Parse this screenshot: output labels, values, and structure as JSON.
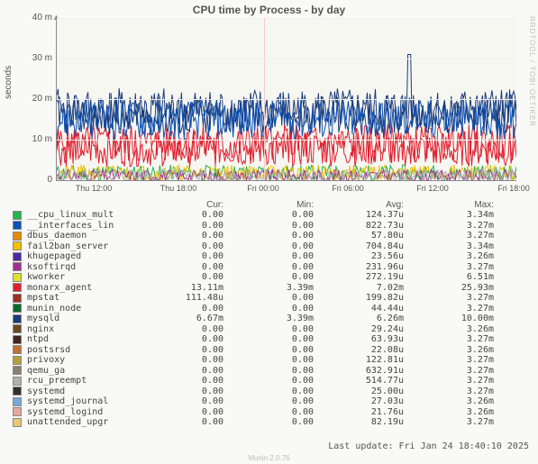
{
  "title": "CPU time by Process - by day",
  "ylabel": "seconds",
  "watermark": "RRDTOOL / TOBI OETIKER",
  "footer": "Munin 2.0.76",
  "last_update": "Last update: Fri Jan 24 18:40:10 2025",
  "y_ticks": [
    "0",
    "10 m",
    "20 m",
    "30 m",
    "40 m"
  ],
  "x_ticks": [
    "Thu 12:00",
    "Thu 18:00",
    "Fri 00:00",
    "Fri 06:00",
    "Fri 12:00",
    "Fri 18:00"
  ],
  "headers": [
    "",
    "Cur:",
    "Min:",
    "Avg:",
    "Max:"
  ],
  "rows": [
    {
      "color": "#27b34f",
      "name": "__cpu_linux_mult",
      "cur": "0.00",
      "min": "0.00",
      "avg": "124.37u",
      "max": "3.34m"
    },
    {
      "color": "#0a52b7",
      "name": "__interfaces_lin",
      "cur": "0.00",
      "min": "0.00",
      "avg": "822.73u",
      "max": "3.27m"
    },
    {
      "color": "#e68a00",
      "name": "dbus_daemon",
      "cur": "0.00",
      "min": "0.00",
      "avg": "57.80u",
      "max": "3.27m"
    },
    {
      "color": "#f0c000",
      "name": "fail2ban_server",
      "cur": "0.00",
      "min": "0.00",
      "avg": "704.84u",
      "max": "3.34m"
    },
    {
      "color": "#4a2aa0",
      "name": "khugepaged",
      "cur": "0.00",
      "min": "0.00",
      "avg": "23.56u",
      "max": "3.26m"
    },
    {
      "color": "#a03090",
      "name": "ksoftirqd",
      "cur": "0.00",
      "min": "0.00",
      "avg": "231.96u",
      "max": "3.27m"
    },
    {
      "color": "#e0e030",
      "name": "kworker",
      "cur": "0.00",
      "min": "0.00",
      "avg": "272.19u",
      "max": "6.51m"
    },
    {
      "color": "#e02030",
      "name": "monarx_agent",
      "cur": "13.11m",
      "min": "3.39m",
      "avg": "7.02m",
      "max": "25.93m"
    },
    {
      "color": "#9a3020",
      "name": "mpstat",
      "cur": "111.48u",
      "min": "0.00",
      "avg": "199.82u",
      "max": "3.27m"
    },
    {
      "color": "#0a6a2a",
      "name": "munin_node",
      "cur": "0.00",
      "min": "0.00",
      "avg": "44.44u",
      "max": "3.27m"
    },
    {
      "color": "#1a3a7a",
      "name": "mysqld",
      "cur": "6.67m",
      "min": "3.39m",
      "avg": "6.26m",
      "max": "10.00m"
    },
    {
      "color": "#6a4a20",
      "name": "nginx",
      "cur": "0.00",
      "min": "0.00",
      "avg": "29.24u",
      "max": "3.26m"
    },
    {
      "color": "#42241f",
      "name": "ntpd",
      "cur": "0.00",
      "min": "0.00",
      "avg": "63.93u",
      "max": "3.27m"
    },
    {
      "color": "#c07030",
      "name": "postsrsd",
      "cur": "0.00",
      "min": "0.00",
      "avg": "22.08u",
      "max": "3.26m"
    },
    {
      "color": "#b0a040",
      "name": "privoxy",
      "cur": "0.00",
      "min": "0.00",
      "avg": "122.81u",
      "max": "3.27m"
    },
    {
      "color": "#8a8070",
      "name": "qemu_ga",
      "cur": "0.00",
      "min": "0.00",
      "avg": "632.91u",
      "max": "3.27m"
    },
    {
      "color": "#b0b0b0",
      "name": "rcu_preempt",
      "cur": "0.00",
      "min": "0.00",
      "avg": "514.77u",
      "max": "3.27m"
    },
    {
      "color": "#303030",
      "name": "systemd",
      "cur": "0.00",
      "min": "0.00",
      "avg": "25.00u",
      "max": "3.27m"
    },
    {
      "color": "#78a8d8",
      "name": "systemd_journal",
      "cur": "0.00",
      "min": "0.00",
      "avg": "27.03u",
      "max": "3.26m"
    },
    {
      "color": "#e8a8a0",
      "name": "systemd_logind",
      "cur": "0.00",
      "min": "0.00",
      "avg": "21.76u",
      "max": "3.26m"
    },
    {
      "color": "#e8c878",
      "name": "unattended_upgr",
      "cur": "0.00",
      "min": "0.00",
      "avg": "82.19u",
      "max": "3.27m"
    }
  ],
  "chart_data": {
    "type": "line",
    "title": "CPU time by Process - by day",
    "xlabel": "",
    "ylabel": "seconds",
    "ylim": [
      0,
      0.04
    ],
    "x_categories": [
      "Thu 12:00",
      "Thu 18:00",
      "Fri 00:00",
      "Fri 06:00",
      "Fri 12:00",
      "Fri 18:00"
    ],
    "note": "Highly oscillating stacked CPU-time-per-process series sampled every 5 minutes. Red (monarx_agent) + dark blue (mysqld) dominate, combining to ~10-20m baseline with frequent spikes to 20-30m. Single tall spike near Fri 11:00 reaches ~31m.",
    "series": [
      {
        "name": "__cpu_linux_mult",
        "avg": 0.00012437,
        "max": 0.00334,
        "color": "#27b34f"
      },
      {
        "name": "__interfaces_lin",
        "avg": 0.00082273,
        "max": 0.00327,
        "color": "#0a52b7"
      },
      {
        "name": "dbus_daemon",
        "avg": 5.78e-05,
        "max": 0.00327,
        "color": "#e68a00"
      },
      {
        "name": "fail2ban_server",
        "avg": 0.00070484,
        "max": 0.00334,
        "color": "#f0c000"
      },
      {
        "name": "khugepaged",
        "avg": 2.356e-05,
        "max": 0.00326,
        "color": "#4a2aa0"
      },
      {
        "name": "ksoftirqd",
        "avg": 0.00023196,
        "max": 0.00327,
        "color": "#a03090"
      },
      {
        "name": "kworker",
        "avg": 0.00027219,
        "max": 0.00651,
        "color": "#e0e030"
      },
      {
        "name": "monarx_agent",
        "avg": 0.00702,
        "max": 0.02593,
        "color": "#e02030"
      },
      {
        "name": "mpstat",
        "avg": 0.00019982,
        "max": 0.00327,
        "color": "#9a3020"
      },
      {
        "name": "munin_node",
        "avg": 4.444e-05,
        "max": 0.00327,
        "color": "#0a6a2a"
      },
      {
        "name": "mysqld",
        "avg": 0.00626,
        "max": 0.01,
        "color": "#1a3a7a"
      },
      {
        "name": "nginx",
        "avg": 2.924e-05,
        "max": 0.00326,
        "color": "#6a4a20"
      },
      {
        "name": "ntpd",
        "avg": 6.393e-05,
        "max": 0.00327,
        "color": "#42241f"
      },
      {
        "name": "postsrsd",
        "avg": 2.208e-05,
        "max": 0.00326,
        "color": "#c07030"
      },
      {
        "name": "privoxy",
        "avg": 0.00012281,
        "max": 0.00327,
        "color": "#b0a040"
      },
      {
        "name": "qemu_ga",
        "avg": 0.00063291,
        "max": 0.00327,
        "color": "#8a8070"
      },
      {
        "name": "rcu_preempt",
        "avg": 0.00051477,
        "max": 0.00327,
        "color": "#b0b0b0"
      },
      {
        "name": "systemd",
        "avg": 2.5e-05,
        "max": 0.00327,
        "color": "#303030"
      },
      {
        "name": "systemd_journal",
        "avg": 2.703e-05,
        "max": 0.00326,
        "color": "#78a8d8"
      },
      {
        "name": "systemd_logind",
        "avg": 2.176e-05,
        "max": 0.00326,
        "color": "#e8a8a0"
      },
      {
        "name": "unattended_upgr",
        "avg": 8.219e-05,
        "max": 0.00327,
        "color": "#e8c878"
      }
    ]
  }
}
